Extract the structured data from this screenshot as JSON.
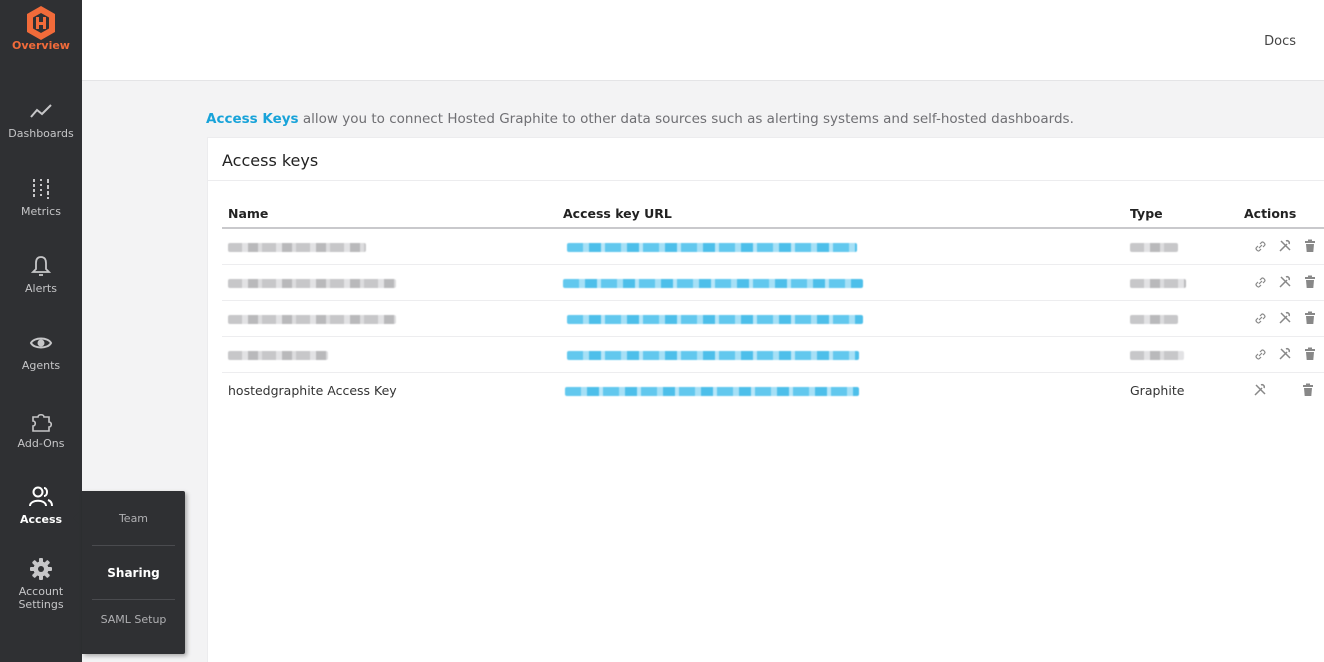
{
  "sidebar": {
    "items": [
      {
        "label": "Overview",
        "icon": "hosted-graphite-logo-icon"
      },
      {
        "label": "Dashboards",
        "icon": "line-chart-icon"
      },
      {
        "label": "Metrics",
        "icon": "metrics-sliders-icon"
      },
      {
        "label": "Alerts",
        "icon": "bell-icon"
      },
      {
        "label": "Agents",
        "icon": "eye-icon"
      },
      {
        "label": "Add-Ons",
        "icon": "puzzle-icon"
      },
      {
        "label": "Access",
        "icon": "users-icon"
      },
      {
        "label": "Account Settings",
        "icon": "gear-icon"
      }
    ],
    "active": "Access",
    "colors": {
      "background": "#2f3033",
      "brand": "#f26b3a"
    }
  },
  "access_flyout": {
    "items": [
      {
        "label": "Team"
      },
      {
        "label": "Sharing"
      },
      {
        "label": "SAML Setup"
      }
    ]
  },
  "topbar": {
    "docs_label": "Docs"
  },
  "intro": {
    "keyword": "Access Keys",
    "text": " allow you to connect Hosted Graphite to other data sources such as alerting systems and self-hosted dashboards."
  },
  "panel": {
    "title": "Access keys",
    "columns": {
      "name": "Name",
      "url": "Access key URL",
      "type": "Type",
      "actions": "Actions"
    },
    "rows": [
      {
        "name": "",
        "url": "",
        "type": "",
        "redacted": true,
        "actions": [
          "link-icon",
          "tools-icon",
          "trash-icon"
        ]
      },
      {
        "name": "",
        "url": "",
        "type": "",
        "redacted": true,
        "actions": [
          "link-icon",
          "tools-icon",
          "trash-icon"
        ]
      },
      {
        "name": "",
        "url": "",
        "type": "",
        "redacted": true,
        "actions": [
          "link-icon",
          "tools-icon",
          "trash-icon"
        ]
      },
      {
        "name": "",
        "url": "",
        "type": "",
        "redacted": true,
        "actions": [
          "link-icon",
          "tools-icon",
          "trash-icon"
        ]
      },
      {
        "name": "hostedgraphite Access Key",
        "url": "",
        "type": "Graphite",
        "redacted_url": true,
        "actions": [
          "tools-icon",
          "trash-icon"
        ]
      }
    ]
  },
  "colors": {
    "accent": "#18a3d9",
    "page_bg": "#f3f3f4"
  }
}
